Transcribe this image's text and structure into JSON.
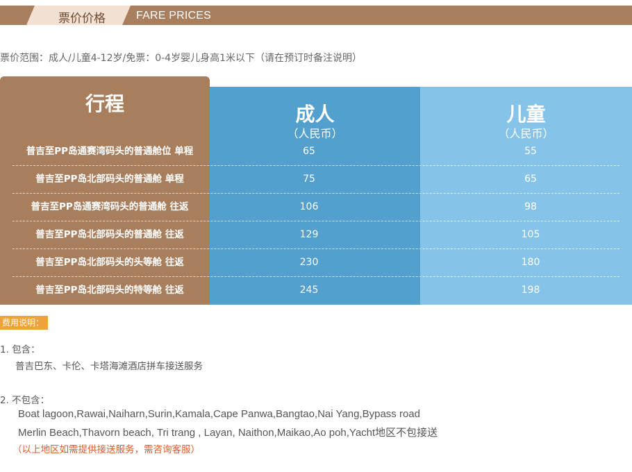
{
  "header": {
    "title_cn": "票价价格",
    "title_en": "FARE PRICES",
    "colors": {
      "bar": "#a97e5c",
      "tab": "#f2e0d2"
    }
  },
  "range_note": "票价范围：成人/儿童4-12岁/免票：0-4岁婴儿身高1米以下（请在预订时备注说明）",
  "table": {
    "headers": {
      "route": "行程",
      "adult": "成人",
      "adult_unit": "（人民币）",
      "child": "儿童",
      "child_unit": "（人民币）"
    },
    "colors": {
      "route": "#a97e5c",
      "adult": "#539fcd",
      "child": "#86c3e8"
    },
    "rows": [
      {
        "route": "普吉至PP岛通赛湾码头的普通舱位  单程",
        "adult": "65",
        "child": "55"
      },
      {
        "route": "普吉至PP岛北部码头的普通舱  单程",
        "adult": "75",
        "child": "65"
      },
      {
        "route": "普吉至PP岛通赛湾码头的普通舱  往返",
        "adult": "106",
        "child": "98"
      },
      {
        "route": "普吉至PP岛北部码头的普通舱  往返",
        "adult": "129",
        "child": "105"
      },
      {
        "route": "普吉至PP岛北部码头的头等舱  往返",
        "adult": "230",
        "child": "180"
      },
      {
        "route": "普吉至PP岛北部码头的特等舱  往返",
        "adult": "245",
        "child": "198"
      }
    ]
  },
  "notes": {
    "badge": "费用说明：",
    "included_title": "1. 包含：",
    "included_text": "普吉巴东、卡伦、卡塔海滩酒店拼车接送服务",
    "excluded_title": "2. 不包含：",
    "excluded_line1": "Boat lagoon,Rawai,Naiharn,Surin,Kamala,Cape Panwa,Bangtao,Nai Yang,Bypass  road",
    "excluded_line2": "Merlin Beach,Thavorn beach, Tri trang , Layan, Naithon,Maikao,Ao poh,Yacht地区不包接送",
    "excluded_note": "（以上地区如需提供接送服务，需咨询客服）",
    "badge_color": "#f0a23a"
  }
}
